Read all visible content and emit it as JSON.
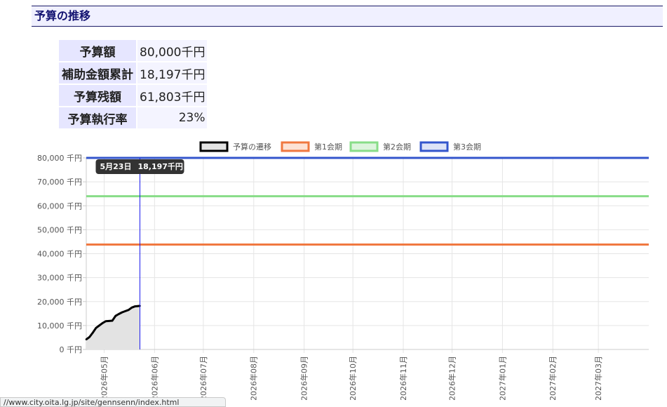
{
  "section": {
    "title": "予算の推移"
  },
  "summary": {
    "rows": [
      {
        "label": "予算額",
        "value": "80,000千円"
      },
      {
        "label": "補助金額累計",
        "value": "18,197千円"
      },
      {
        "label": "予算残額",
        "value": "61,803千円"
      },
      {
        "label": "予算執行率",
        "value": "23%"
      }
    ]
  },
  "chart_data": {
    "type": "line",
    "y_unit": "千円",
    "ylim": [
      0,
      80000
    ],
    "yticks": [
      "80,000 千円",
      "70,000 千円",
      "60,000 千円",
      "50,000 千円",
      "40,000 千円",
      "30,000 千円",
      "20,000 千円",
      "10,000 千円",
      "0 千円"
    ],
    "x_range": [
      "2026-04-20",
      "2027-04-01"
    ],
    "month_ticks": [
      {
        "label": "2026年05月",
        "date": "2026-05-01"
      },
      {
        "label": "2026年06月",
        "date": "2026-06-01"
      },
      {
        "label": "2026年07月",
        "date": "2026-07-01"
      },
      {
        "label": "2026年08月",
        "date": "2026-08-01"
      },
      {
        "label": "2026年09月",
        "date": "2026-09-01"
      },
      {
        "label": "2026年10月",
        "date": "2026-10-01"
      },
      {
        "label": "2026年11月",
        "date": "2026-11-01"
      },
      {
        "label": "2026年12月",
        "date": "2026-12-01"
      },
      {
        "label": "2027年01月",
        "date": "2027-01-01"
      },
      {
        "label": "2027年02月",
        "date": "2027-02-01"
      },
      {
        "label": "2027年03月",
        "date": "2027-03-01"
      }
    ],
    "grid": true,
    "legend_position": "top",
    "series": [
      {
        "name": "予算の遷移",
        "color": "#000000",
        "fill": "#e3e3e3",
        "points": [
          {
            "x": "2026-04-20",
            "y": 4200
          },
          {
            "x": "2026-04-22",
            "y": 5200
          },
          {
            "x": "2026-04-24",
            "y": 7000
          },
          {
            "x": "2026-04-26",
            "y": 9000
          },
          {
            "x": "2026-04-28",
            "y": 10000
          },
          {
            "x": "2026-04-30",
            "y": 11000
          },
          {
            "x": "2026-05-02",
            "y": 11800
          },
          {
            "x": "2026-05-04",
            "y": 11900
          },
          {
            "x": "2026-05-06",
            "y": 12000
          },
          {
            "x": "2026-05-08",
            "y": 14000
          },
          {
            "x": "2026-05-10",
            "y": 14800
          },
          {
            "x": "2026-05-12",
            "y": 15500
          },
          {
            "x": "2026-05-14",
            "y": 16000
          },
          {
            "x": "2026-05-16",
            "y": 16500
          },
          {
            "x": "2026-05-18",
            "y": 17500
          },
          {
            "x": "2026-05-20",
            "y": 18000
          },
          {
            "x": "2026-05-23",
            "y": 18197
          }
        ]
      },
      {
        "name": "第1会期",
        "color": "#f07840",
        "fill": "#fde2d5",
        "y": 43800
      },
      {
        "name": "第2会期",
        "color": "#88dd88",
        "fill": "#ddf4dd",
        "y": 64000
      },
      {
        "name": "第3会期",
        "color": "#3355cc",
        "fill": "#dde3f7",
        "y": 80000
      }
    ],
    "tooltip": {
      "date": "5月23日",
      "value": "18,197千円",
      "x": "2026-05-23"
    }
  },
  "status_bar": {
    "url": "//www.city.oita.lg.jp/site/gennsenn/index.html"
  }
}
